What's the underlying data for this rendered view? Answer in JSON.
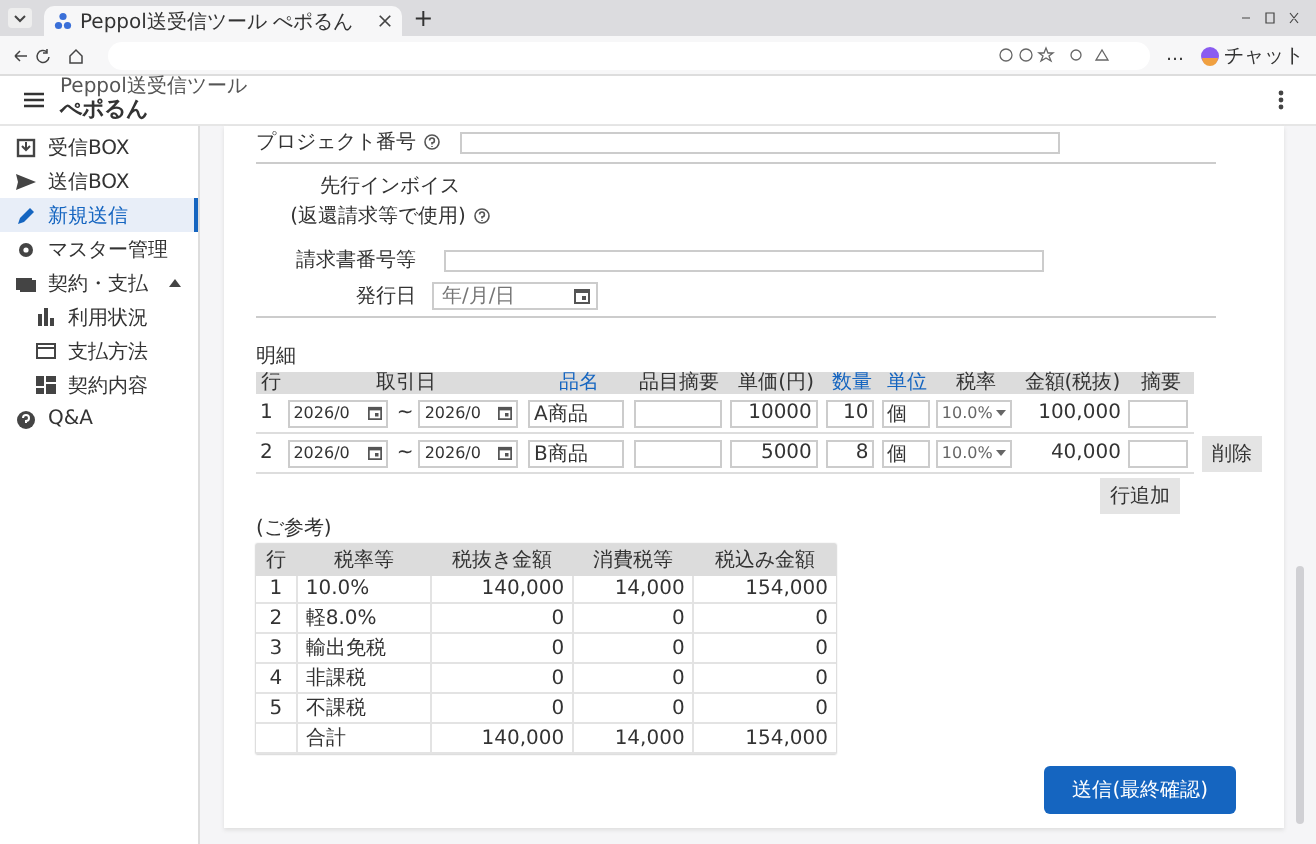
{
  "browser": {
    "tab_title": "Peppol送受信ツール ぺポるん",
    "new_tab": "+",
    "menu": "…",
    "chat": "チャット"
  },
  "app_header": {
    "subtitle": "Peppol送受信ツール",
    "title": "ぺポるん"
  },
  "sidebar": {
    "items": [
      {
        "label": "受信BOX",
        "selected": false
      },
      {
        "label": "送信BOX",
        "selected": false
      },
      {
        "label": "新規送信",
        "selected": true
      },
      {
        "label": "マスター管理",
        "selected": false
      },
      {
        "label": "契約・支払",
        "selected": false,
        "expanded": true,
        "children": [
          {
            "label": "利用状況",
            "selected": false
          },
          {
            "label": "支払方法",
            "selected": false
          },
          {
            "label": "契約内容",
            "selected": false
          }
        ]
      },
      {
        "label": "Q&A",
        "selected": false
      }
    ]
  },
  "form": {
    "project": {
      "label": "プロジェクト番号"
    },
    "preceding_invoice": {
      "label": "先行インボイス",
      "note": "(返還請求等で使用)"
    },
    "invoice_number": {
      "label": "請求書番号等"
    },
    "issue_date": {
      "label": "発行日",
      "placeholder": "年/月/日"
    }
  },
  "details": {
    "title": "明細",
    "columns": [
      "行",
      "取引日",
      "品名",
      "品目摘要",
      "単価(円)",
      "数量",
      "単位",
      "税率",
      "金額(税抜)",
      "摘要"
    ],
    "rows": [
      {
        "no": "1",
        "date_from": "2026/0",
        "sep": "~",
        "date_to": "2026/0",
        "item": "A商品",
        "unit_price": "10000",
        "qty": "10",
        "unit": "個",
        "tax_rate": "10.0%",
        "amount": "100,000"
      },
      {
        "no": "2",
        "date_from": "2026/0",
        "sep": "~",
        "date_to": "2026/0",
        "item": "B商品",
        "unit_price": "5000",
        "qty": "8",
        "unit": "個",
        "tax_rate": "10.0%",
        "amount": "40,000",
        "delete": "削除"
      }
    ],
    "add_row": "行追加"
  },
  "summary": {
    "title": "(ご参考)",
    "columns": [
      "行",
      "税率等",
      "税抜き金額",
      "消費税等",
      "税込み金額"
    ],
    "rows": [
      [
        "1",
        "10.0%",
        "140,000",
        "14,000",
        "154,000"
      ],
      [
        "2",
        "軽8.0%",
        "0",
        "0",
        "0"
      ],
      [
        "3",
        "輸出免税",
        "0",
        "0",
        "0"
      ],
      [
        "4",
        "非課税",
        "0",
        "0",
        "0"
      ],
      [
        "5",
        "不課税",
        "0",
        "0",
        "0"
      ],
      [
        "",
        "合計",
        "140,000",
        "14,000",
        "154,000"
      ]
    ]
  },
  "submit_button": "送信(最終確認)"
}
